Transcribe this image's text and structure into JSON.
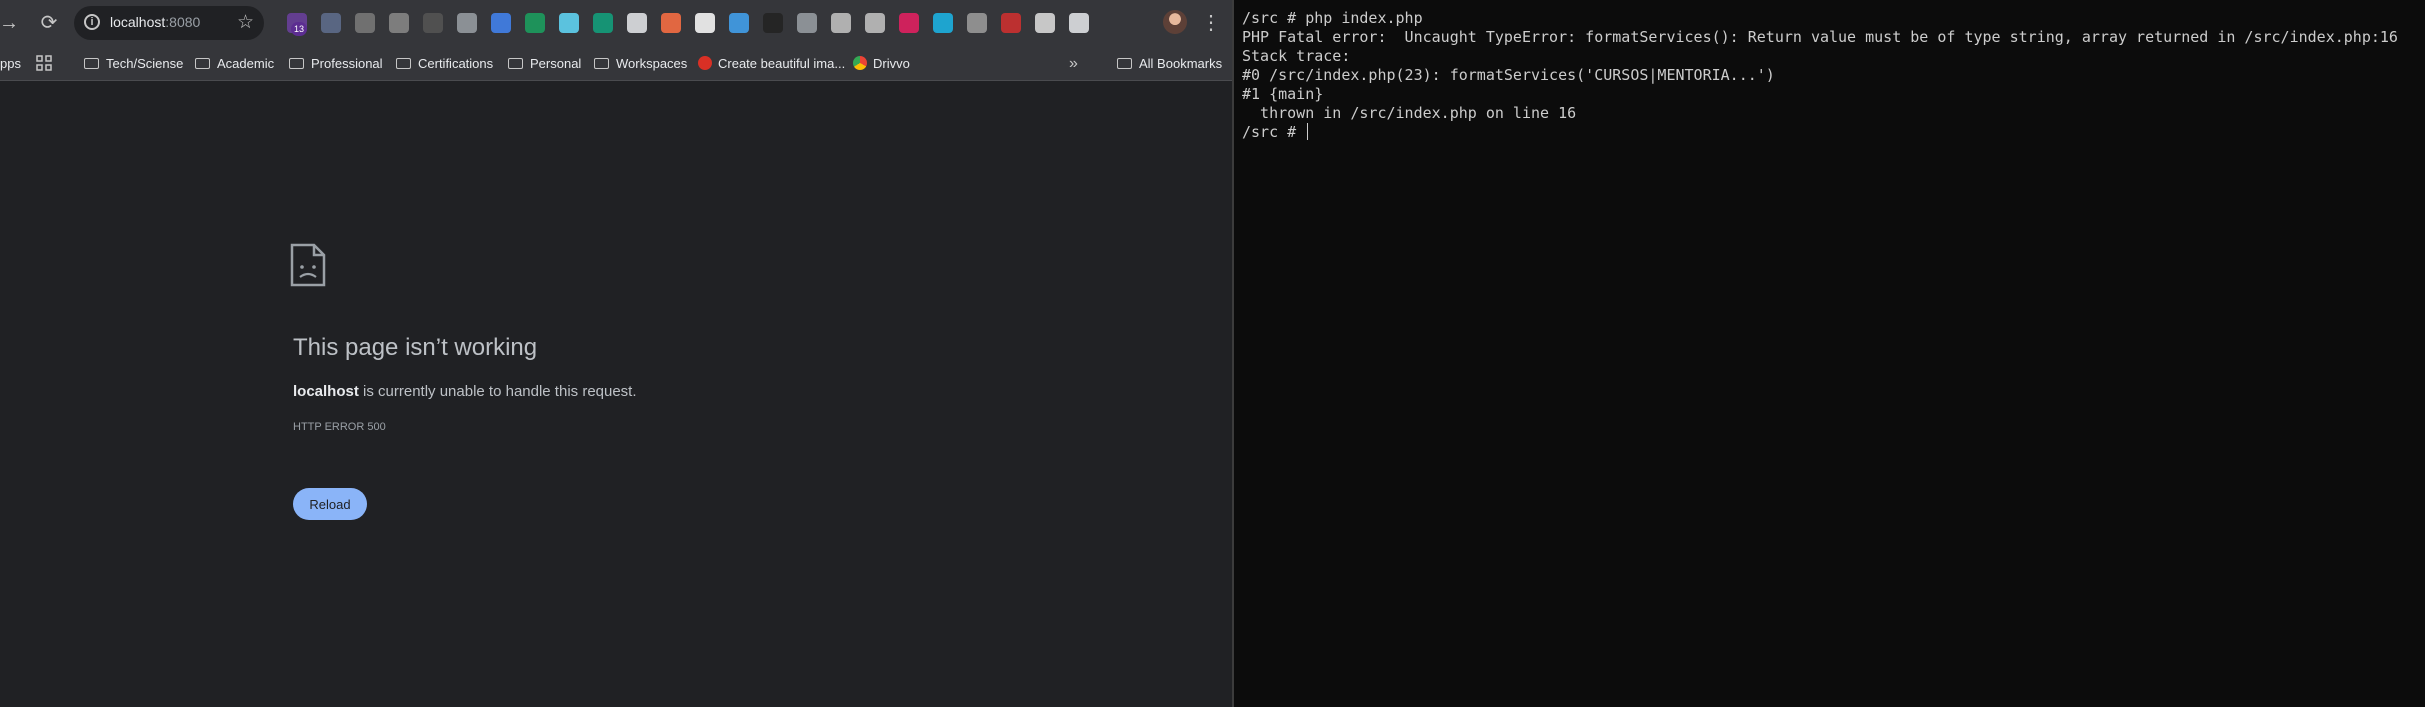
{
  "browser": {
    "toolbar": {
      "url_host": "localhost",
      "url_port": ":8080",
      "extension_badge": "13",
      "extensions": [
        "purple-extension-icon",
        "robot-extension-icon",
        "reader-extension-icon",
        "camera-extension-icon",
        "circle-extension-icon",
        "c-extension-icon",
        "translate-extension-icon",
        "js-extension-icon",
        "react-extension-icon",
        "chatgpt-extension-icon",
        "screenshot-extension-icon",
        "fire-extension-icon",
        "headset-extension-icon",
        "wave-extension-icon",
        "hat-extension-icon",
        "settings-extension-icon",
        "vue-extension-icon",
        "target-extension-icon",
        "heart-extension-icon",
        "vimeo-extension-icon",
        "qr-extension-icon",
        "pdf-extension-icon",
        "cat-extension-icon",
        "puzzle-extension-icon"
      ]
    },
    "bookmarks": {
      "apps_label": "pps",
      "items": [
        {
          "label": "Tech/Sciense",
          "icon": "folder-icon"
        },
        {
          "label": "Academic",
          "icon": "folder-icon"
        },
        {
          "label": "Professional",
          "icon": "folder-icon"
        },
        {
          "label": "Certifications",
          "icon": "folder-icon"
        },
        {
          "label": "Personal",
          "icon": "folder-icon"
        },
        {
          "label": "Workspaces",
          "icon": "folder-icon"
        },
        {
          "label": "Create beautiful ima...",
          "icon": "site-icon"
        },
        {
          "label": "Drivvo",
          "icon": "chrome-icon"
        }
      ],
      "all_bookmarks": "All Bookmarks"
    },
    "error_page": {
      "title": "This page isn’t working",
      "host": "localhost",
      "message": " is currently unable to handle this request.",
      "code": "HTTP ERROR 500",
      "reload_label": "Reload"
    }
  },
  "terminal": {
    "lines": [
      "/src # php index.php",
      "PHP Fatal error:  Uncaught TypeError: formatServices(): Return value must be of type string, array returned in /src/index.php:16",
      "Stack trace:",
      "#0 /src/index.php(23): formatServices('CURSOS|MENTORIA...')",
      "#1 {main}",
      "  thrown in /src/index.php on line 16"
    ],
    "prompt": "/src # "
  },
  "colors": {
    "browser_bg": "#202124",
    "toolbar_bg": "#35363a",
    "reload_bg": "#8ab4f8",
    "terminal_bg": "#0c0c0c",
    "terminal_text": "#cccccc"
  }
}
